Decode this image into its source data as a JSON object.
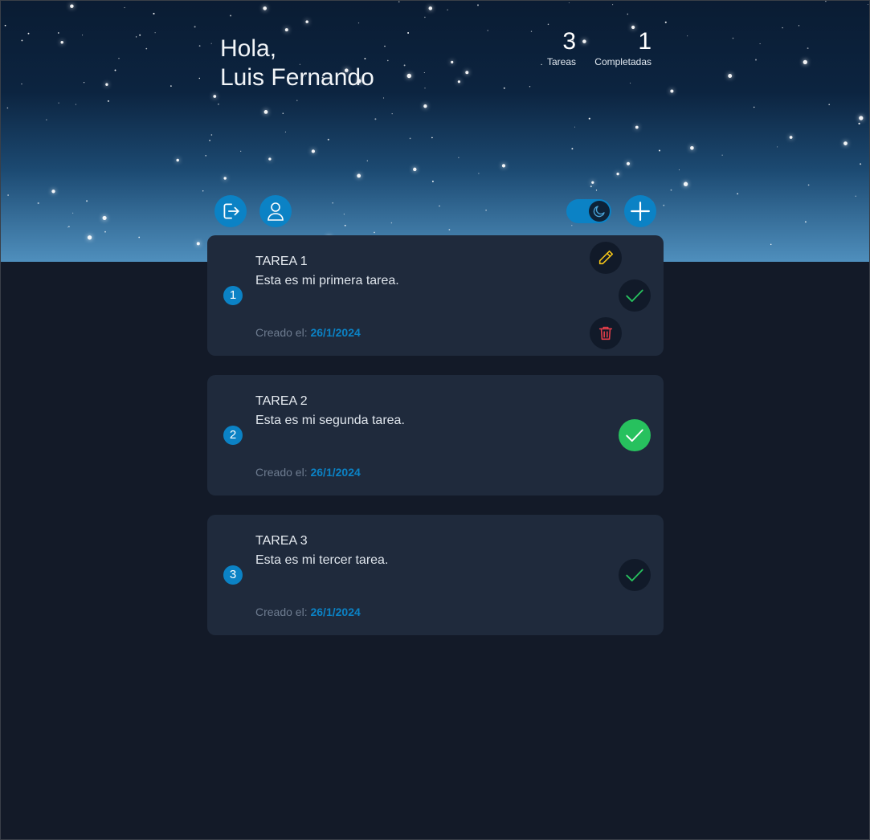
{
  "header": {
    "greeting": "Hola,",
    "user_name": "Luis Fernando",
    "stats": {
      "tasks_count": "3",
      "tasks_label": "Tareas",
      "completed_count": "1",
      "completed_label": "Completadas"
    }
  },
  "toolbar": {
    "logout_icon": "logout-icon",
    "profile_icon": "user-icon",
    "theme_toggle": {
      "mode": "dark",
      "icon": "moon-icon"
    },
    "add_icon": "plus-icon"
  },
  "colors": {
    "accent": "#0b82c5",
    "background": "#131a28",
    "card": "#1f2a3c",
    "edit": "#f5c518",
    "complete": "#27c15e",
    "delete": "#e53e4a"
  },
  "tasks": [
    {
      "number": "1",
      "title": "TAREA 1",
      "description": "Esta es mi primera tarea.",
      "created_label": "Creado el:",
      "created_date": "26/1/2024",
      "completed": false,
      "actions_expanded": true
    },
    {
      "number": "2",
      "title": "TAREA 2",
      "description": "Esta es mi segunda tarea.",
      "created_label": "Creado el:",
      "created_date": "26/1/2024",
      "completed": true,
      "actions_expanded": false
    },
    {
      "number": "3",
      "title": "TAREA 3",
      "description": "Esta es mi tercer tarea.",
      "created_label": "Creado el:",
      "created_date": "26/1/2024",
      "completed": false,
      "actions_expanded": false
    }
  ]
}
